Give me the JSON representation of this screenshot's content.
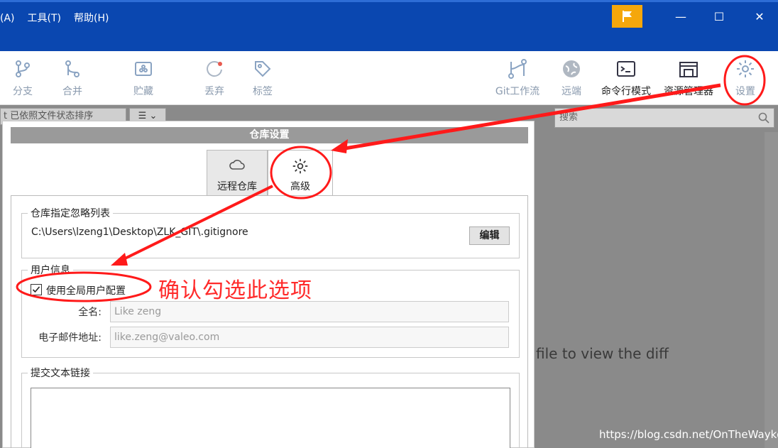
{
  "menu": {
    "items": [
      "库(A)",
      "工具(T)",
      "帮助(H)"
    ]
  },
  "window_controls": {
    "minimize": "—",
    "maximize": "☐",
    "close": "✕"
  },
  "toolbar": {
    "branch": "分支",
    "merge": "合并",
    "stash": "贮藏",
    "discard": "丢弃",
    "tag": "标签",
    "gitflow": "Git工作流",
    "remote": "远端",
    "terminal": "命令行模式",
    "explorer": "资源管理器",
    "settings": "设置"
  },
  "filter": {
    "sort_label": "t 已依照文件状态排序",
    "view_label": "☰ ⌄"
  },
  "search": {
    "placeholder": "搜索"
  },
  "diff_hint": "file to view the diff",
  "dialog": {
    "title": "仓库设置",
    "tabs": [
      {
        "label": "远程仓库",
        "icon": "cloud-icon"
      },
      {
        "label": "高级",
        "icon": "gear-icon"
      }
    ],
    "ignore_group": {
      "title": "仓库指定忽略列表",
      "path": "C:\\Users\\lzeng1\\Desktop\\ZLK_GIT\\.gitignore",
      "edit_label": "编辑"
    },
    "user_group": {
      "title": "用户信息",
      "use_global_label": "使用全局用户配置",
      "use_global_checked": true,
      "fullname_label": "全名:",
      "fullname_value": "Like zeng",
      "email_label": "电子邮件地址:",
      "email_value": "like.zeng@valeo.com"
    },
    "commit_group": {
      "title": "提交文本链接"
    }
  },
  "annotation": {
    "text": "确认勾选此选项",
    "color": "#ff2a2a"
  },
  "watermark": "https://blog.csdn.net/OnTheWaykd",
  "colors": {
    "titlebar": "#0a47b0",
    "flag": "#f5a70b",
    "annotation": "#ff2a2a"
  }
}
